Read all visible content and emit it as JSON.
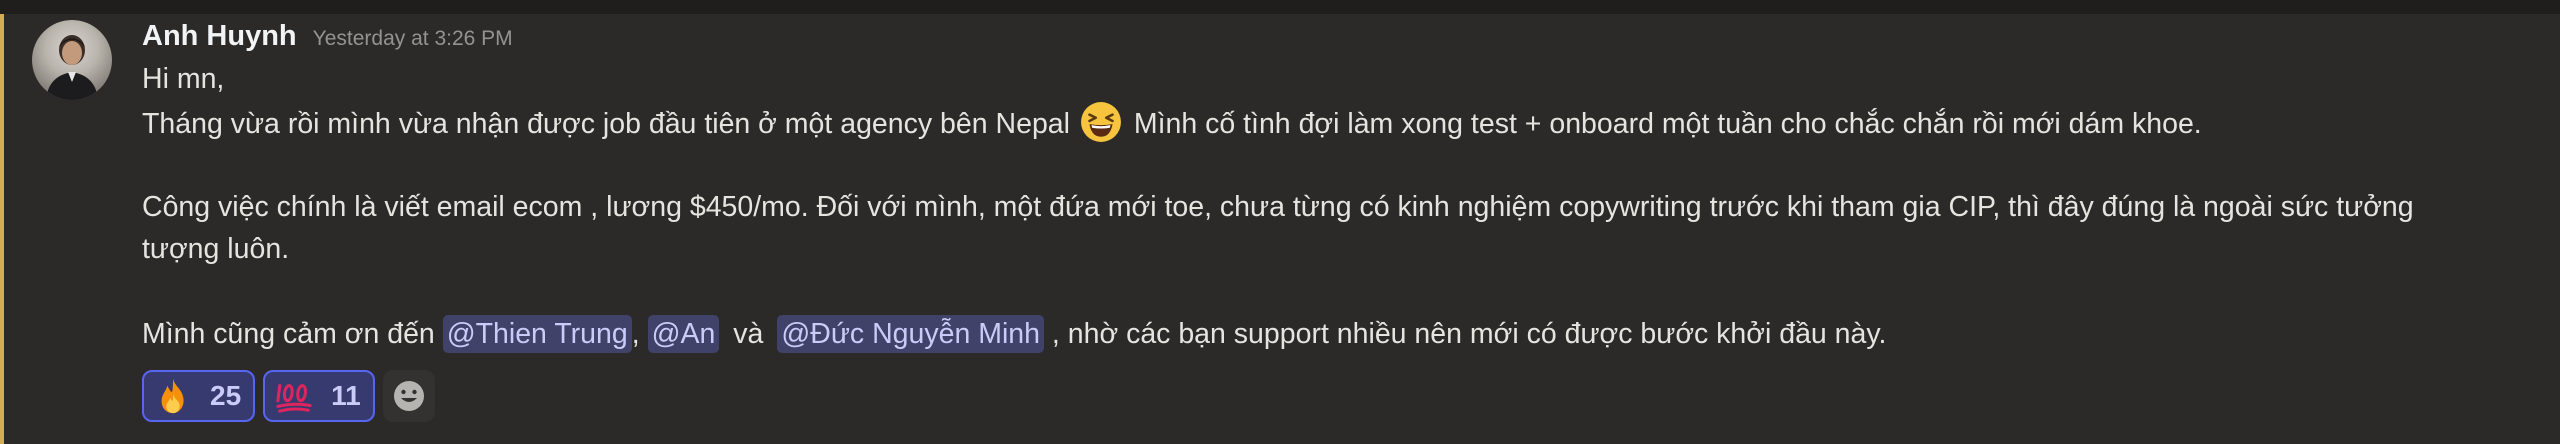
{
  "message": {
    "author": "Anh Huynh",
    "timestamp": "Yesterday at 3:26 PM",
    "lines": {
      "l1": "Hi mn,",
      "l2a": "Tháng vừa rồi mình vừa nhận được job đầu tiên ở một agency bên Nepal",
      "l2b": "Mình cố tình đợi làm xong test + onboard một tuần cho chắc chắn rồi mới dám khoe.",
      "l3": "Công việc chính là viết email ecom , lương $450/mo. Đối với mình, một đứa mới toe, chưa từng có kinh nghiệm copywriting trước khi tham gia CIP, thì đây đúng là ngoài sức tưởng",
      "l4": "tượng luôn.",
      "l5a": "Mình cũng cảm ơn đến",
      "l5b": ",",
      "l5c": "và",
      "l5d": ", nhờ các bạn support nhiều nên mới có được bước khởi đầu này."
    },
    "mentions": [
      "@Thien Trung",
      "@An",
      "@Đức Nguyễn Minh"
    ],
    "inline_emoji": "laughing-face"
  },
  "reactions": [
    {
      "emoji": "fire",
      "count": "25"
    },
    {
      "emoji": "hundred-points",
      "count": "11"
    }
  ],
  "colors": {
    "background": "#2b2a29",
    "mention_highlight_bar": "#d3ab52",
    "mention_bg": "#41426a",
    "mention_text": "#c9ccf8",
    "reaction_border": "#5865f2"
  }
}
